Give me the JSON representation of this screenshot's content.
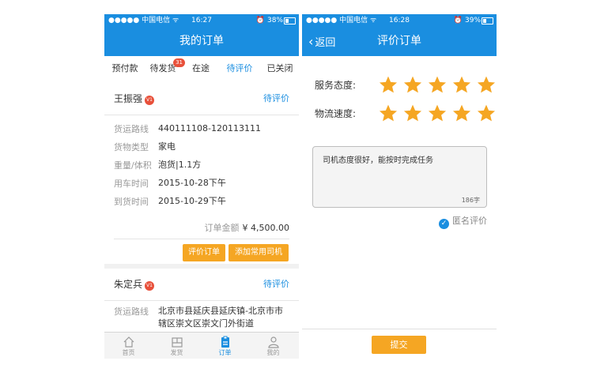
{
  "left": {
    "status_bar": {
      "carrier": "●●●●● 中国电信 ᯤ",
      "time": "16:27",
      "battery": "⏰ 38%",
      "battery_level": 0.38
    },
    "nav_title": "我的订单",
    "tabs": [
      {
        "label": "预付款"
      },
      {
        "label": "待发货",
        "badge": "31"
      },
      {
        "label": "在途"
      },
      {
        "label": "待评价",
        "active": true
      },
      {
        "label": "已关闭"
      }
    ],
    "orders": [
      {
        "name": "王振强",
        "vip": "V1",
        "status": "待评价",
        "fields": [
          {
            "key": "货运路线",
            "value": "440111108-120113111"
          },
          {
            "key": "货物类型",
            "value": "家电"
          },
          {
            "key": "重量/体积",
            "value": "泡货|1.1方"
          },
          {
            "key": "用车时间",
            "value": "2015-10-28下午"
          },
          {
            "key": "到货时间",
            "value": "2015-10-29下午"
          }
        ],
        "amount_label": "订单金额",
        "amount_value": "¥ 4,500.00",
        "actions": [
          "评价订单",
          "添加常用司机"
        ]
      },
      {
        "name": "朱定兵",
        "vip": "V1",
        "status": "待评价",
        "fields": [
          {
            "key": "货运路线",
            "value": "北京市县延庆县延庆镇-北京市市辖区崇文区崇文门外街道"
          }
        ]
      }
    ],
    "bottom_nav": [
      {
        "label": "首页",
        "icon": "home-icon"
      },
      {
        "label": "发货",
        "icon": "ship-icon"
      },
      {
        "label": "订单",
        "icon": "order-icon",
        "active": true
      },
      {
        "label": "我的",
        "icon": "user-icon"
      }
    ]
  },
  "right": {
    "status_bar": {
      "carrier": "●●●●● 中国电信 ᯤ",
      "time": "16:28",
      "battery": "⏰ 39%",
      "battery_level": 0.39
    },
    "back_label": "返回",
    "nav_title": "评价订单",
    "ratings": [
      {
        "label": "服务态度:",
        "stars": 5,
        "max": 5
      },
      {
        "label": "物流速度:",
        "stars": 5,
        "max": 5
      }
    ],
    "comment": {
      "text": "司机态度很好，能按时完成任务",
      "count": "186字"
    },
    "anonymous": {
      "label": "匿名评价",
      "checked": true
    },
    "submit_label": "提交"
  },
  "colors": {
    "brand_blue": "#1a8ee0",
    "accent_orange": "#f5a623",
    "badge_red": "#e8503a"
  }
}
